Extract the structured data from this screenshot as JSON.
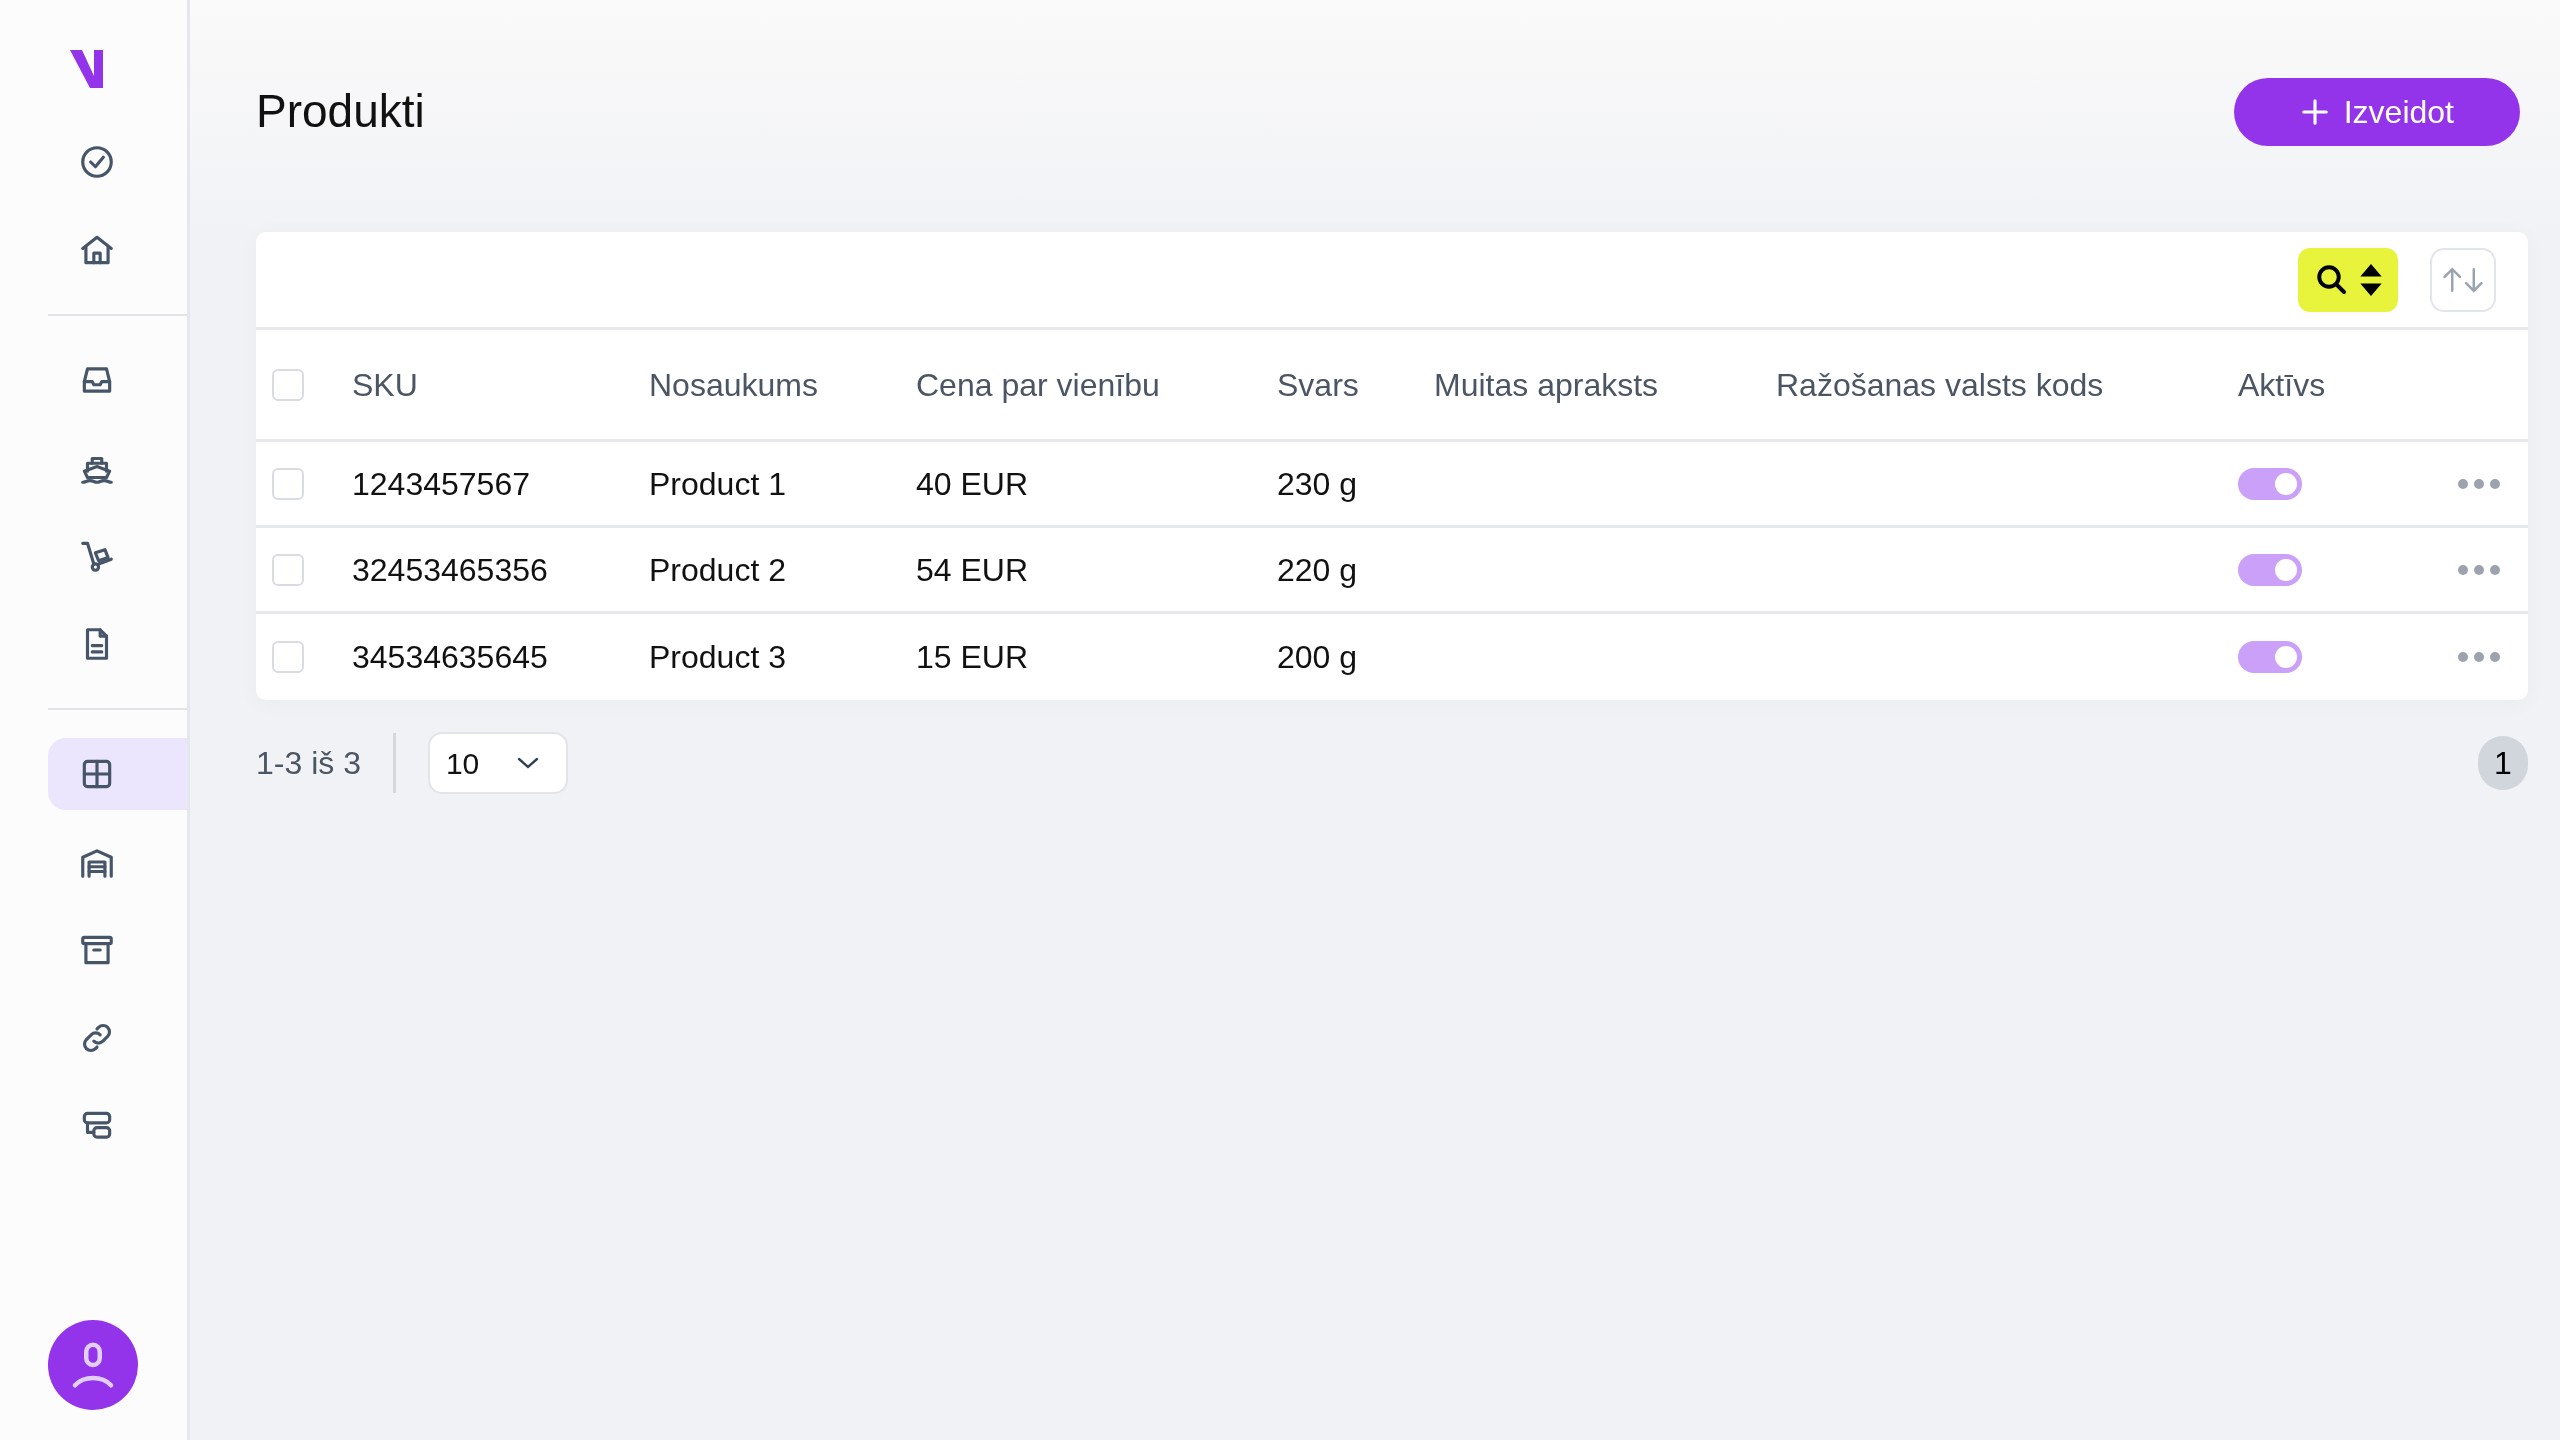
{
  "sidebar": {
    "groups": [
      [
        {
          "selected": false
        },
        {
          "selected": false
        }
      ],
      [
        {
          "selected": false
        },
        {
          "selected": false
        },
        {
          "selected": false
        },
        {
          "selected": false
        }
      ],
      [
        {
          "selected": true
        },
        {
          "selected": false
        },
        {
          "selected": false
        },
        {
          "selected": false
        },
        {
          "selected": false
        }
      ]
    ]
  },
  "page": {
    "title": "Produkti",
    "create_button": "Izveidot"
  },
  "table": {
    "select_all": {
      "checked": false
    },
    "columns": [
      "SKU",
      "Nosaukums",
      "Cena par vienību",
      "Svars",
      "Muitas apraksts",
      "Ražošanas valsts kods",
      "Aktīvs"
    ],
    "rows": [
      {
        "checked": false,
        "sku": "1243457567",
        "name": "Product 1",
        "price": "40 EUR",
        "weight": "230 g",
        "customs": "",
        "country": "",
        "active": true
      },
      {
        "checked": false,
        "sku": "32453465356",
        "name": "Product 2",
        "price": "54 EUR",
        "weight": "220 g",
        "customs": "",
        "country": "",
        "active": true
      },
      {
        "checked": false,
        "sku": "34534635645",
        "name": "Product 3",
        "price": "15 EUR",
        "weight": "200 g",
        "customs": "",
        "country": "",
        "active": true
      }
    ]
  },
  "footer": {
    "range": "1-3 iš 3",
    "page_size": "10",
    "pages": [
      {
        "label": "1",
        "selected": true
      }
    ]
  }
}
